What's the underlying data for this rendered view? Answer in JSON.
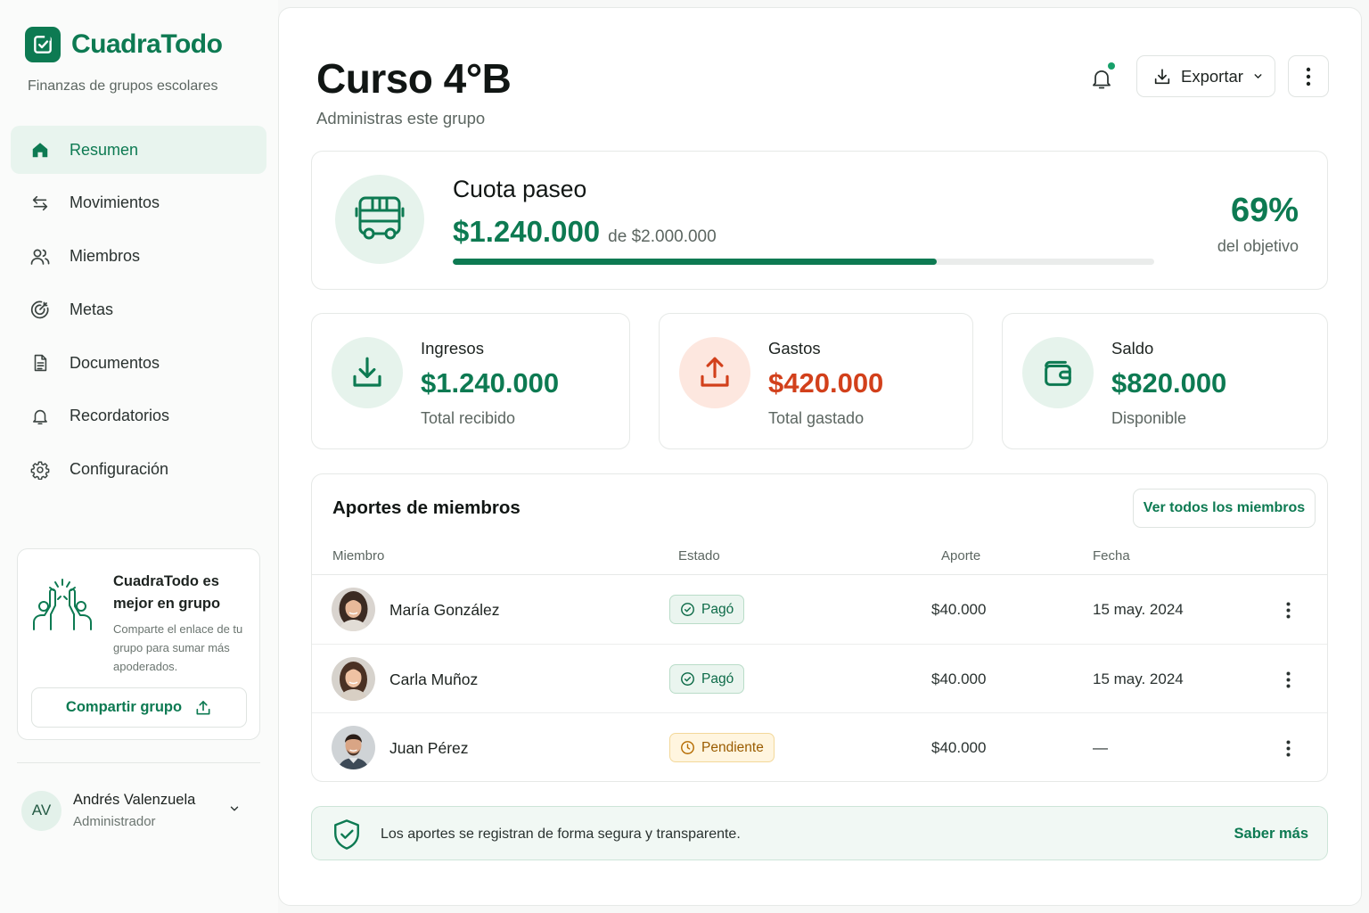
{
  "app": {
    "name": "CuadraTodo",
    "tagline": "Finanzas de grupos escolares",
    "accent_color": "#0d7a52"
  },
  "sidebar": {
    "items": [
      {
        "label": "Resumen",
        "icon": "home-icon",
        "active": true
      },
      {
        "label": "Movimientos",
        "icon": "arrows-swap-icon",
        "active": false
      },
      {
        "label": "Miembros",
        "icon": "users-icon",
        "active": false
      },
      {
        "label": "Metas",
        "icon": "target-icon",
        "active": false
      },
      {
        "label": "Documentos",
        "icon": "document-icon",
        "active": false
      },
      {
        "label": "Recordatorios",
        "icon": "bell-icon",
        "active": false
      },
      {
        "label": "Configuración",
        "icon": "gear-icon",
        "active": false
      }
    ],
    "promo": {
      "title": "CuadraTodo es mejor en grupo",
      "text": "Comparte el enlace de tu grupo para sumar más apoderados.",
      "button_label": "Compartir grupo"
    },
    "user": {
      "initials": "AV",
      "name": "Andrés Valenzuela",
      "role": "Administrador"
    }
  },
  "header": {
    "title": "Curso 4°B",
    "subtitle": "Administras este grupo",
    "export_label": "Exportar",
    "has_notifications": true
  },
  "goal": {
    "title": "Cuota paseo",
    "amount": "$1.240.000",
    "target": "de $2.000.000",
    "progress_fraction": 0.69,
    "percent": "69%",
    "percent_label": "del objetivo"
  },
  "stats": [
    {
      "label": "Ingresos",
      "value": "$1.240.000",
      "sub": "Total recibido",
      "color": "#0d7a52",
      "icon": "download-icon"
    },
    {
      "label": "Gastos",
      "value": "$420.000",
      "sub": "Total gastado",
      "color": "#d2401b",
      "icon": "upload-icon"
    },
    {
      "label": "Saldo",
      "value": "$820.000",
      "sub": "Disponible",
      "color": "#0d7a52",
      "icon": "wallet-icon"
    }
  ],
  "members": {
    "title": "Aportes de miembros",
    "view_all_label": "Ver todos los miembros",
    "columns": [
      "Miembro",
      "Estado",
      "Aporte",
      "Fecha"
    ],
    "rows": [
      {
        "name": "María González",
        "status": "Pagó",
        "status_type": "paid",
        "amount": "$40.000",
        "date": "15 may. 2024"
      },
      {
        "name": "Carla Muñoz",
        "status": "Pagó",
        "status_type": "paid",
        "amount": "$40.000",
        "date": "15 may. 2024"
      },
      {
        "name": "Juan Pérez",
        "status": "Pendiente",
        "status_type": "pending",
        "amount": "$40.000",
        "date": "—"
      }
    ]
  },
  "info": {
    "text": "Los aportes se registran de forma segura y transparente.",
    "link_label": "Saber más"
  }
}
